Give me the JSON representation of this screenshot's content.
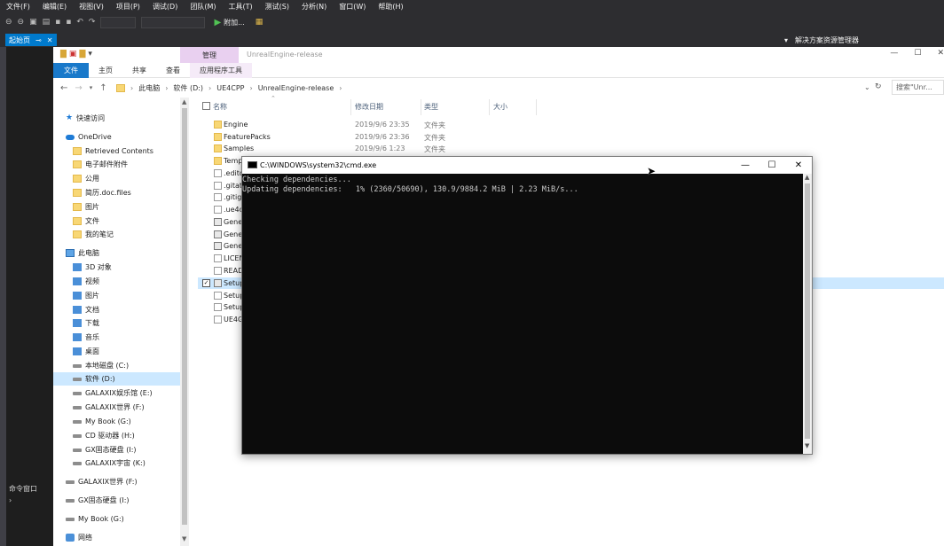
{
  "vs": {
    "menu": [
      "文件(F)",
      "编辑(E)",
      "视图(V)",
      "项目(P)",
      "调试(D)",
      "团队(M)",
      "工具(T)",
      "测试(S)",
      "分析(N)",
      "窗口(W)",
      "帮助(H)"
    ],
    "attach_label": "附加...",
    "start_tab": "起始页",
    "start_tab_pin": "⊸",
    "start_tab_close": "✕",
    "solution_explorer": "解决方案资源管理器",
    "command_window": "命令窗口"
  },
  "explorer": {
    "manage_tab": "管理",
    "title": "UnrealEngine-release",
    "ribbon_tabs": [
      "文件",
      "主页",
      "共享",
      "查看",
      "应用程序工具"
    ],
    "breadcrumb": [
      "此电脑",
      "软件 (D:)",
      "UE4CPP",
      "UnrealEngine-release"
    ],
    "search_placeholder": "搜索\"Unr...",
    "columns": {
      "name": "名称",
      "date": "修改日期",
      "type": "类型",
      "size": "大小"
    },
    "nav_items": [
      {
        "label": "快速访问",
        "icon": "star-icon"
      },
      {
        "label": "OneDrive",
        "icon": "cloud-icon"
      },
      {
        "label": "Retrieved Contents",
        "icon": "folder-icon"
      },
      {
        "label": "电子邮件附件",
        "icon": "folder-icon"
      },
      {
        "label": "公用",
        "icon": "folder-icon"
      },
      {
        "label": "简历.doc.files",
        "icon": "folder-icon"
      },
      {
        "label": "图片",
        "icon": "folder-icon"
      },
      {
        "label": "文件",
        "icon": "folder-icon"
      },
      {
        "label": "我的笔记",
        "icon": "folder-icon"
      },
      {
        "label": "此电脑",
        "icon": "pc-icon"
      },
      {
        "label": "3D 对象",
        "icon": "cube-icon"
      },
      {
        "label": "视频",
        "icon": "video-icon"
      },
      {
        "label": "图片",
        "icon": "pictures-icon"
      },
      {
        "label": "文档",
        "icon": "documents-icon"
      },
      {
        "label": "下载",
        "icon": "download-icon"
      },
      {
        "label": "音乐",
        "icon": "music-icon"
      },
      {
        "label": "桌面",
        "icon": "desktop-icon"
      },
      {
        "label": "本地磁盘 (C:)",
        "icon": "drive-icon"
      },
      {
        "label": "软件 (D:)",
        "icon": "drive-icon",
        "selected": true
      },
      {
        "label": "GALAXIX娱乐馆 (E:)",
        "icon": "drive-icon"
      },
      {
        "label": "GALAXIX世界 (F:)",
        "icon": "drive-icon"
      },
      {
        "label": "My Book (G:)",
        "icon": "drive-icon"
      },
      {
        "label": "CD 驱动器 (H:)",
        "icon": "cd-icon"
      },
      {
        "label": "GX固态硬盘 (I:)",
        "icon": "drive-icon"
      },
      {
        "label": "GALAXIX宇宙 (K:)",
        "icon": "drive-icon"
      },
      {
        "label": "GALAXIX世界 (F:)",
        "icon": "drive-icon"
      },
      {
        "label": "GX固态硬盘 (I:)",
        "icon": "drive-icon"
      },
      {
        "label": "My Book (G:)",
        "icon": "drive-icon"
      },
      {
        "label": "网络",
        "icon": "network-icon"
      }
    ],
    "files": [
      {
        "name": "Engine",
        "date": "2019/9/6 23:35",
        "type": "文件夹",
        "icon": "folder"
      },
      {
        "name": "FeaturePacks",
        "date": "2019/9/6 23:36",
        "type": "文件夹",
        "icon": "folder"
      },
      {
        "name": "Samples",
        "date": "2019/9/6 1:23",
        "type": "文件夹",
        "icon": "folder"
      },
      {
        "name": "Temp",
        "date": "",
        "type": "",
        "icon": "folder"
      },
      {
        "name": ".edito",
        "date": "",
        "type": "",
        "icon": "doc"
      },
      {
        "name": ".gitat",
        "date": "",
        "type": "",
        "icon": "doc"
      },
      {
        "name": ".gitig",
        "date": "",
        "type": "",
        "icon": "doc"
      },
      {
        "name": ".ue4d",
        "date": "",
        "type": "",
        "icon": "doc"
      },
      {
        "name": "Gene",
        "date": "",
        "type": "",
        "icon": "exe"
      },
      {
        "name": "Gene",
        "date": "",
        "type": "",
        "icon": "exe"
      },
      {
        "name": "Gene",
        "date": "",
        "type": "",
        "icon": "exe"
      },
      {
        "name": "LICEN",
        "date": "",
        "type": "",
        "icon": "doc"
      },
      {
        "name": "READ",
        "date": "",
        "type": "",
        "icon": "doc"
      },
      {
        "name": "Setup",
        "date": "",
        "type": "",
        "icon": "exe",
        "checked": true
      },
      {
        "name": "Setup",
        "date": "",
        "type": "",
        "icon": "doc"
      },
      {
        "name": "Setup",
        "date": "",
        "type": "",
        "icon": "doc"
      },
      {
        "name": "UE4G",
        "date": "",
        "type": "",
        "icon": "doc"
      }
    ]
  },
  "cmd": {
    "title": "C:\\WINDOWS\\system32\\cmd.exe",
    "lines": [
      "Checking dependencies...",
      "Updating dependencies:   1% (2360/50690), 130.9/9884.2 MiB | 2.23 MiB/s..."
    ]
  }
}
